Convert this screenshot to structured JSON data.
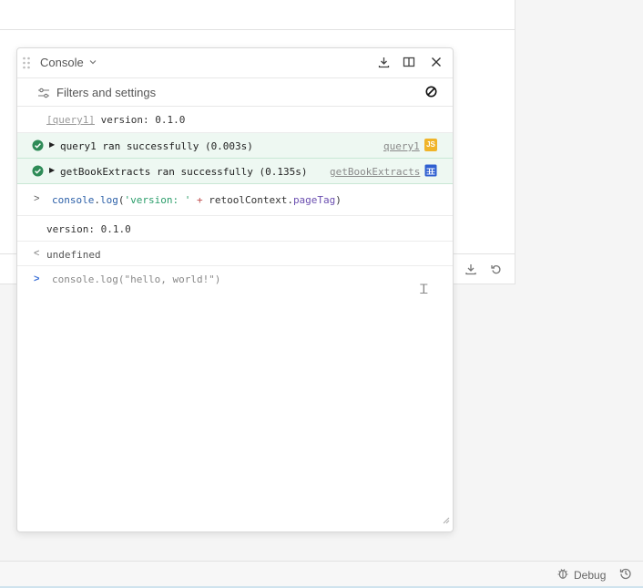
{
  "console": {
    "title": "Console",
    "filters_label": "Filters and settings",
    "logs": [
      {
        "type": "plain",
        "source": "[query1]",
        "text": "version: 0.1.0"
      },
      {
        "type": "success",
        "text": "query1 ran successfully (0.003s)",
        "source": "query1",
        "badge": "JS"
      },
      {
        "type": "success",
        "text": "getBookExtracts ran successfully (0.135s)",
        "source": "getBookExtracts",
        "badge": "table-icon"
      }
    ],
    "input_echo": {
      "prompt": ">",
      "parts": {
        "fn1": "console",
        "dot1": ".",
        "fn2": "log",
        "open": "(",
        "str": "'version: '",
        "plus": " + ",
        "ctx": "retoolContext",
        "dot2": ".",
        "prop": "pageTag",
        "close": ")"
      }
    },
    "output": "version: 0.1.0",
    "return_value": "undefined",
    "return_arrow": "<",
    "current_input": "console.log(\"hello, world!\")",
    "current_prompt": ">"
  },
  "statusbar": {
    "debug_label": "Debug"
  },
  "colors": {
    "success_bg": "#eef8f2",
    "success_check": "#2e8b57",
    "js_badge": "#f0b429",
    "table_badge": "#2f5fd0",
    "prompt_blue": "#3b6fd6"
  }
}
